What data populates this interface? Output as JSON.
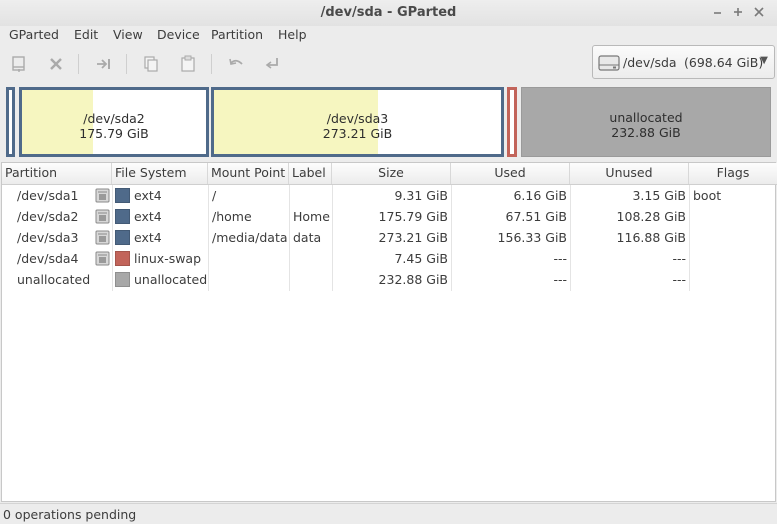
{
  "window": {
    "title": "/dev/sda - GParted",
    "controls": [
      "minimize-icon",
      "maximize-icon",
      "close-icon"
    ]
  },
  "menu": [
    "GParted",
    "Edit",
    "View",
    "Device",
    "Partition",
    "Help"
  ],
  "toolbar": {
    "buttons": [
      "new-partition-icon",
      "delete-icon",
      "resize-move-icon",
      "copy-icon",
      "paste-icon",
      "undo-icon",
      "apply-icon"
    ]
  },
  "device_selector": {
    "device": "/dev/sda",
    "size": "(698.64 GiB)",
    "icon": "harddisk-icon"
  },
  "partition_map": {
    "sda2": {
      "name": "/dev/sda2",
      "size": "175.79 GiB",
      "used_fraction": 0.384
    },
    "sda3": {
      "name": "/dev/sda3",
      "size": "273.21 GiB",
      "used_fraction": 0.572
    },
    "unallocated": {
      "name": "unallocated",
      "size": "232.88 GiB"
    }
  },
  "table": {
    "headers": {
      "partition": "Partition",
      "filesystem": "File System",
      "mountpoint": "Mount Point",
      "label": "Label",
      "size": "Size",
      "used": "Used",
      "unused": "Unused",
      "flags": "Flags"
    },
    "rows": [
      {
        "partition": "/dev/sda1",
        "filesystem": "ext4",
        "fs_color": "#4f6a8a",
        "mountpoint": "/",
        "label": "",
        "size": "9.31 GiB",
        "used": "6.16 GiB",
        "unused": "3.15 GiB",
        "flags": "boot"
      },
      {
        "partition": "/dev/sda2",
        "filesystem": "ext4",
        "fs_color": "#4f6a8a",
        "mountpoint": "/home",
        "label": "Home",
        "size": "175.79 GiB",
        "used": "67.51 GiB",
        "unused": "108.28 GiB",
        "flags": ""
      },
      {
        "partition": "/dev/sda3",
        "filesystem": "ext4",
        "fs_color": "#4f6a8a",
        "mountpoint": "/media/data",
        "label": "data",
        "size": "273.21 GiB",
        "used": "156.33 GiB",
        "unused": "116.88 GiB",
        "flags": ""
      },
      {
        "partition": "/dev/sda4",
        "filesystem": "linux-swap",
        "fs_color": "#c2645a",
        "mountpoint": "",
        "label": "",
        "size": "7.45 GiB",
        "used": "---",
        "unused": "---",
        "flags": ""
      },
      {
        "partition": "unallocated",
        "filesystem": "unallocated",
        "fs_color": "#a8a8a8",
        "mountpoint": "",
        "label": "",
        "size": "232.88 GiB",
        "used": "---",
        "unused": "---",
        "flags": ""
      }
    ]
  },
  "status": {
    "text": "0 operations pending"
  },
  "colors": {
    "ext4": "#4f6a8a",
    "linux_swap": "#c2645a",
    "unallocated": "#a8a8a8",
    "used_fill": "#f6f6c0"
  }
}
